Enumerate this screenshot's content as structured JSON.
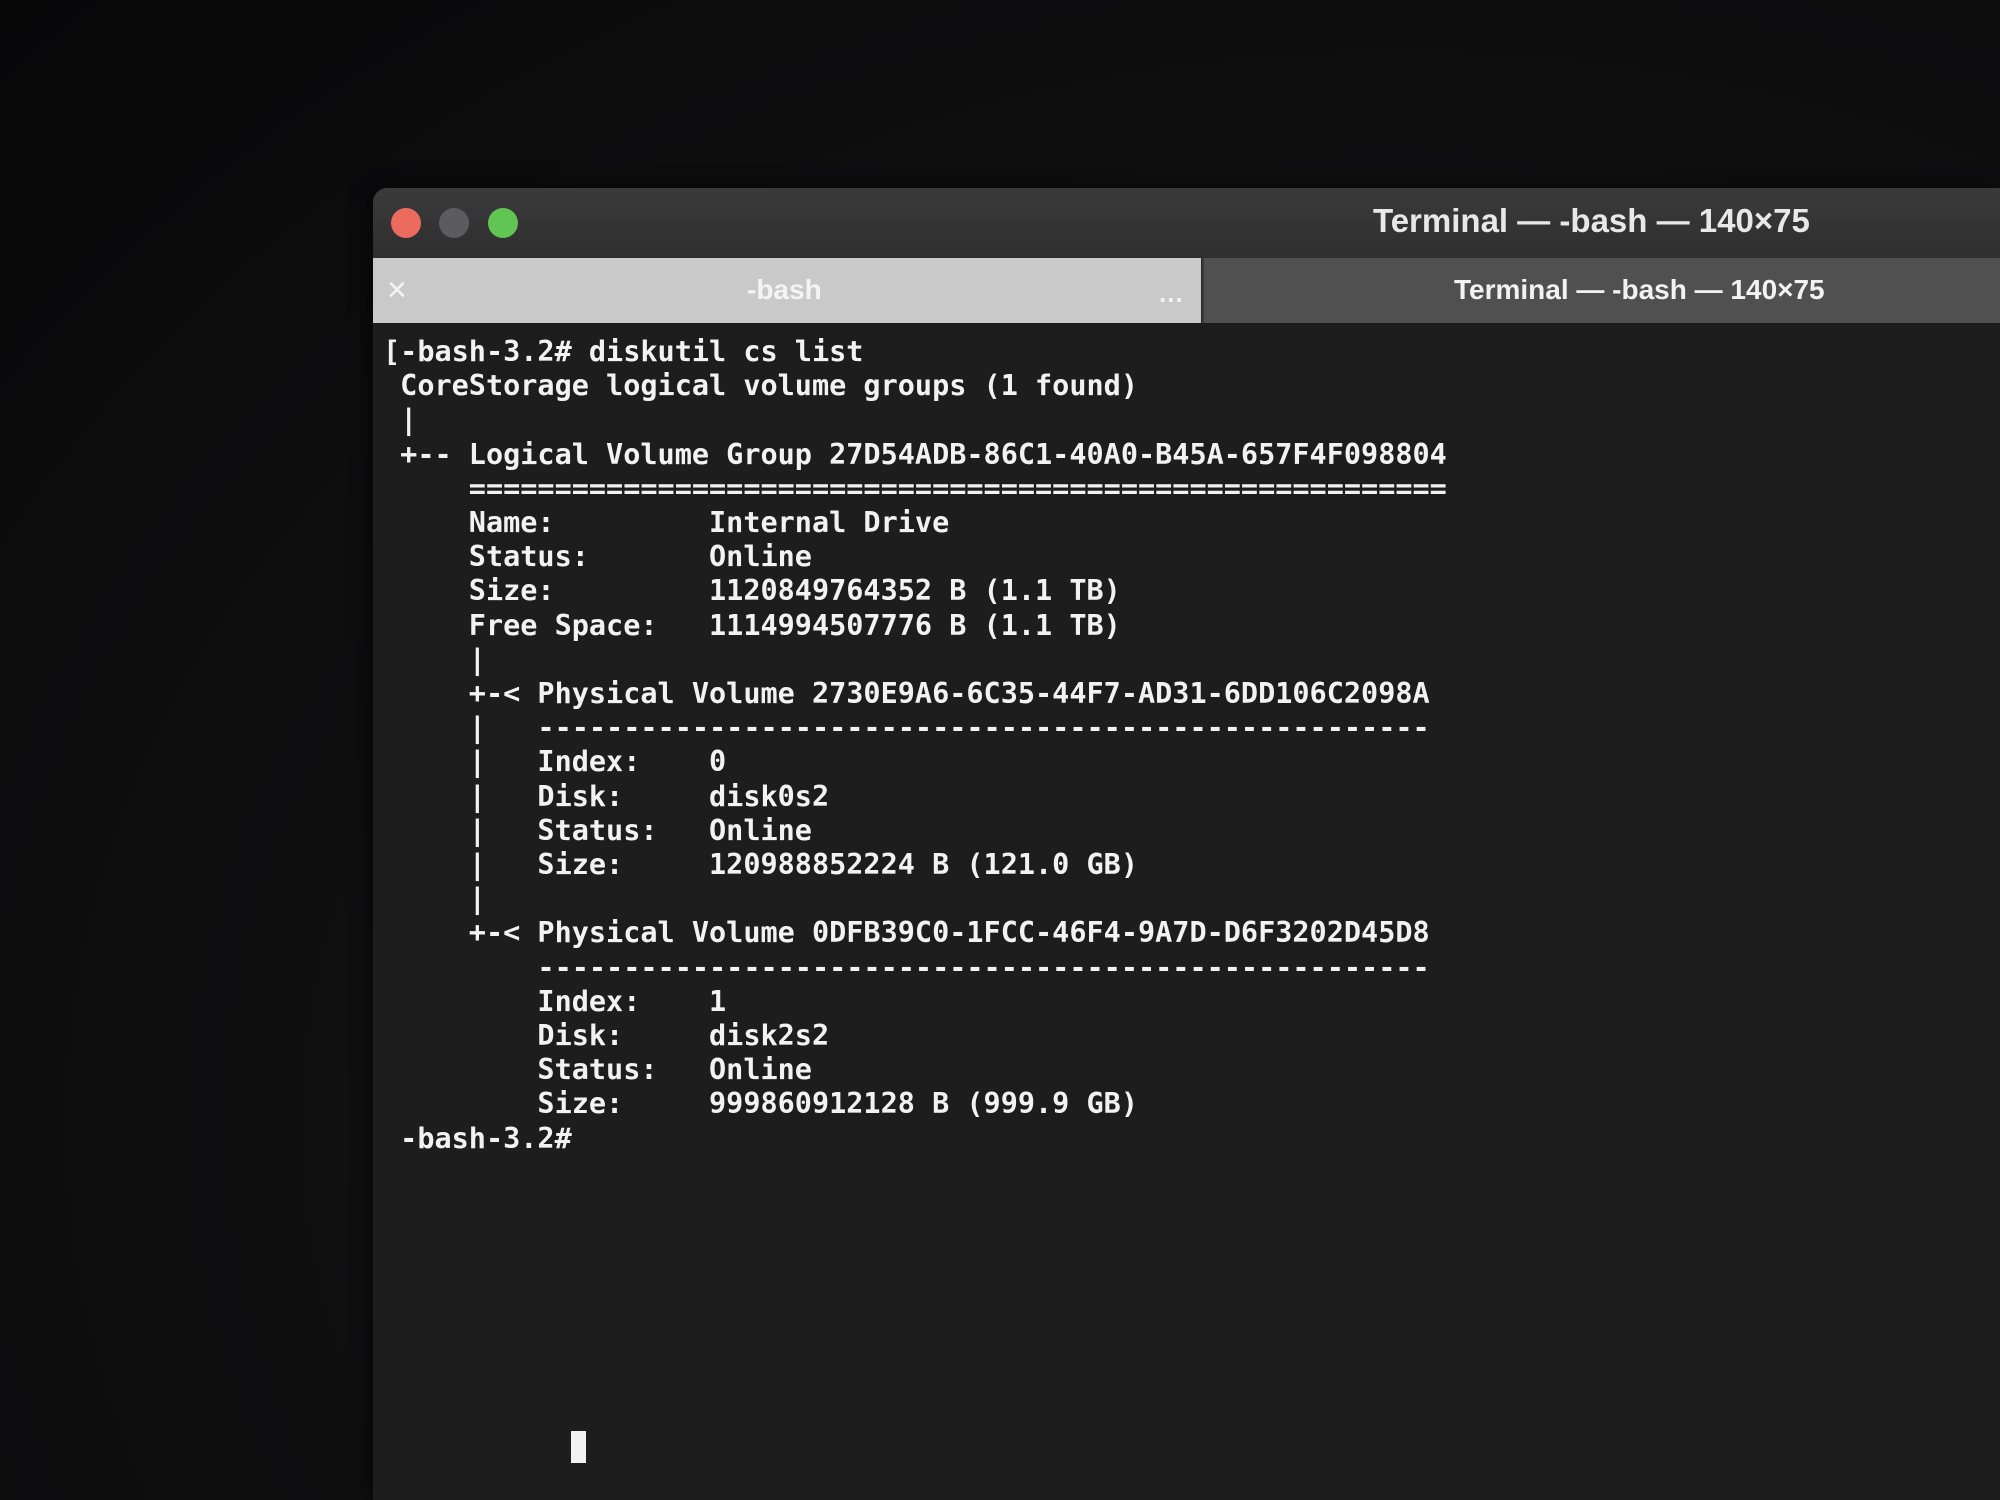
{
  "window": {
    "title": "Terminal — -bash — 140×75"
  },
  "tabs": [
    {
      "label": "-bash",
      "close_icon": "×",
      "more_icon": "..."
    },
    {
      "label": "Terminal — -bash — 140×75"
    }
  ],
  "terminal": {
    "lines": [
      "[-bash-3.2# diskutil cs list",
      " CoreStorage logical volume groups (1 found)",
      " |",
      " +-- Logical Volume Group 27D54ADB-86C1-40A0-B45A-657F4F098804",
      "     =========================================================",
      "     Name:         Internal Drive",
      "     Status:       Online",
      "     Size:         1120849764352 B (1.1 TB)",
      "     Free Space:   1114994507776 B (1.1 TB)",
      "     |",
      "     +-< Physical Volume 2730E9A6-6C35-44F7-AD31-6DD106C2098A",
      "     |   ----------------------------------------------------",
      "     |   Index:    0",
      "     |   Disk:     disk0s2",
      "     |   Status:   Online",
      "     |   Size:     120988852224 B (121.0 GB)",
      "     |",
      "     +-< Physical Volume 0DFB39C0-1FCC-46F4-9A7D-D6F3202D45D8",
      "         ----------------------------------------------------",
      "         Index:    1",
      "         Disk:     disk2s2",
      "         Status:   Online",
      "         Size:     999860912128 B (999.9 GB)",
      " -bash-3.2# "
    ]
  }
}
